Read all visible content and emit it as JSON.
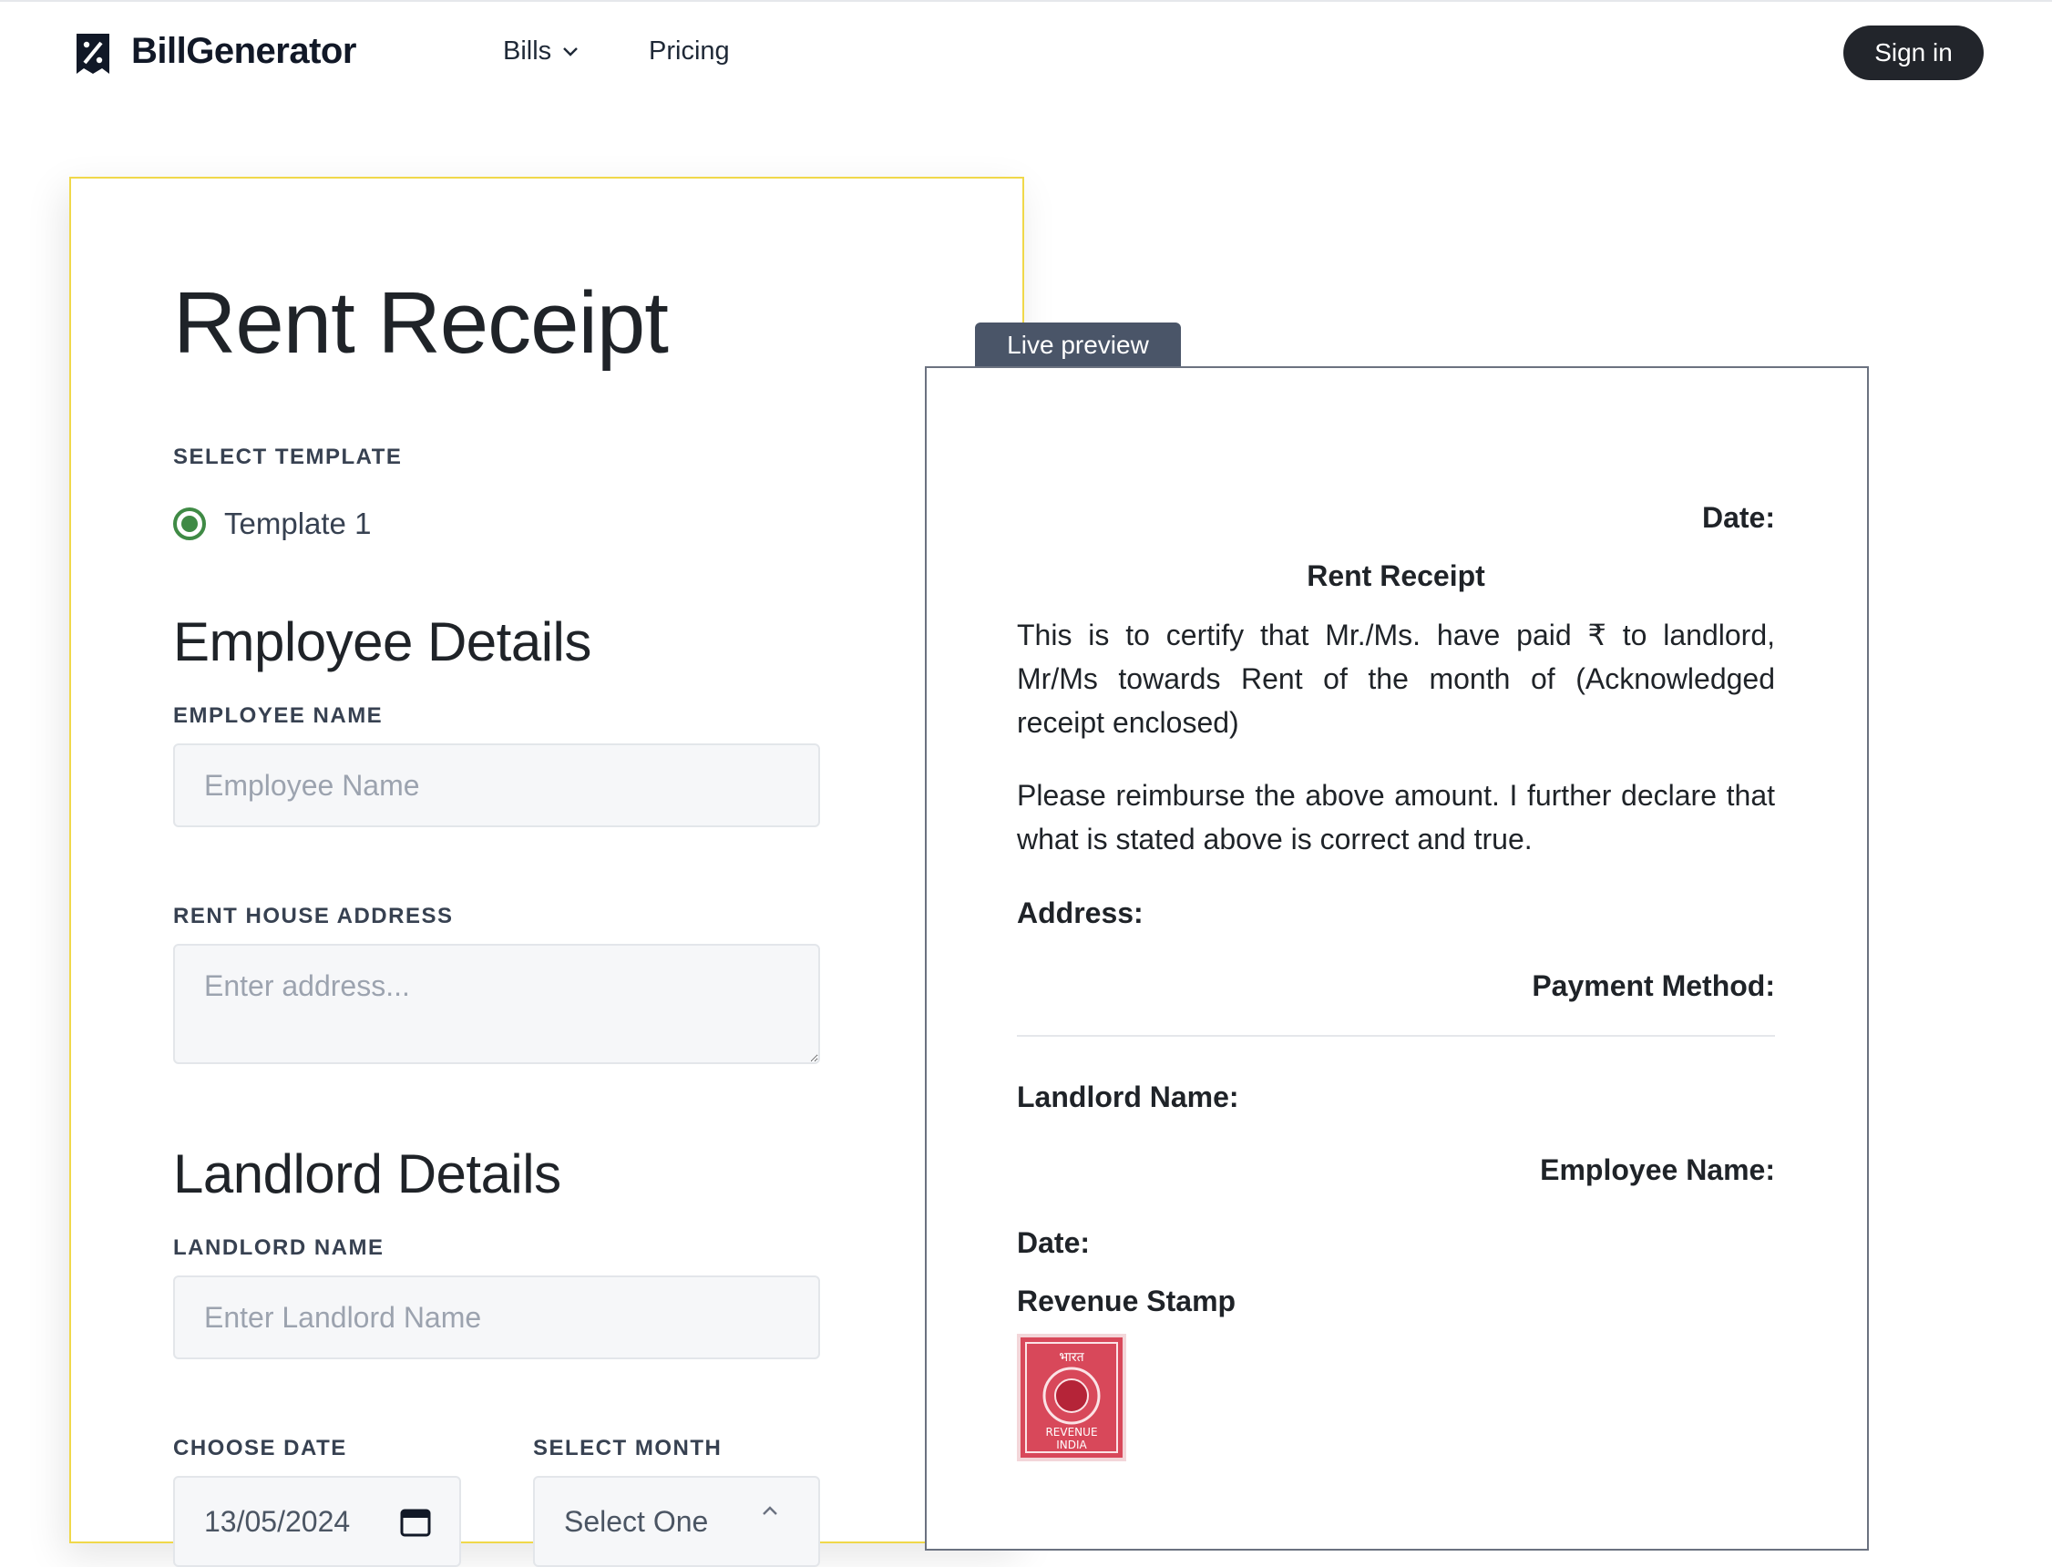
{
  "header": {
    "brand": "BillGenerator",
    "nav": {
      "bills": "Bills",
      "pricing": "Pricing"
    },
    "signin": "Sign in"
  },
  "form": {
    "title": "Rent Receipt",
    "template_label": "SELECT TEMPLATE",
    "template_option": "Template 1",
    "employee_section": "Employee Details",
    "employee_name_label": "EMPLOYEE NAME",
    "employee_name_placeholder": "Employee Name",
    "address_label": "RENT HOUSE ADDRESS",
    "address_placeholder": "Enter address...",
    "landlord_section": "Landlord Details",
    "landlord_name_label": "LANDLORD NAME",
    "landlord_name_placeholder": "Enter Landlord Name",
    "date_label": "CHOOSE DATE",
    "date_value": "13/05/2024",
    "month_label": "SELECT MONTH",
    "month_value": "Select One"
  },
  "preview": {
    "tab": "Live preview",
    "date": "Date:",
    "title": "Rent Receipt",
    "para1": "This is to certify that Mr./Ms. have paid ₹ to landlord, Mr/Ms towards Rent of the month of (Acknowledged receipt enclosed)",
    "para2": "Please reimburse the above amount. I further declare that what is stated above is correct and true.",
    "address": "Address:",
    "payment_method": "Payment Method:",
    "landlord_name": "Landlord Name:",
    "employee_name": "Employee Name:",
    "date2": "Date:",
    "revenue_stamp": "Revenue Stamp",
    "stamp_text_top": "भारत",
    "stamp_text_mid": "REVENUE",
    "stamp_text_bottom": "INDIA"
  },
  "colors": {
    "accent_green": "#3f8a45",
    "card_border": "#f0d84a",
    "signin_bg": "#22252b",
    "tab_bg": "#4a5568",
    "stamp_red": "#c8283c"
  }
}
